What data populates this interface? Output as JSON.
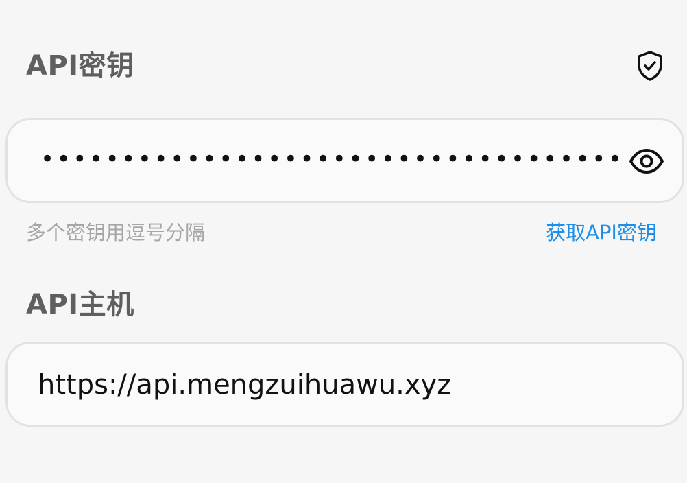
{
  "api_key": {
    "title": "API密钥",
    "masked_value": "••••••••••••••••••••••••••••••••••••",
    "shield_icon": "shield-check-icon",
    "visibility_icon": "eye-icon",
    "hint": "多个密钥用逗号分隔",
    "get_key_link": "获取API密钥"
  },
  "api_host": {
    "title": "API主机",
    "value": "https://api.mengzuihuawu.xyz"
  },
  "colors": {
    "background": "#f6f6f6",
    "title": "#5f5f5f",
    "link": "#1e8fe8",
    "hint": "#a6a6a6",
    "field_border": "#e2e2e2"
  }
}
